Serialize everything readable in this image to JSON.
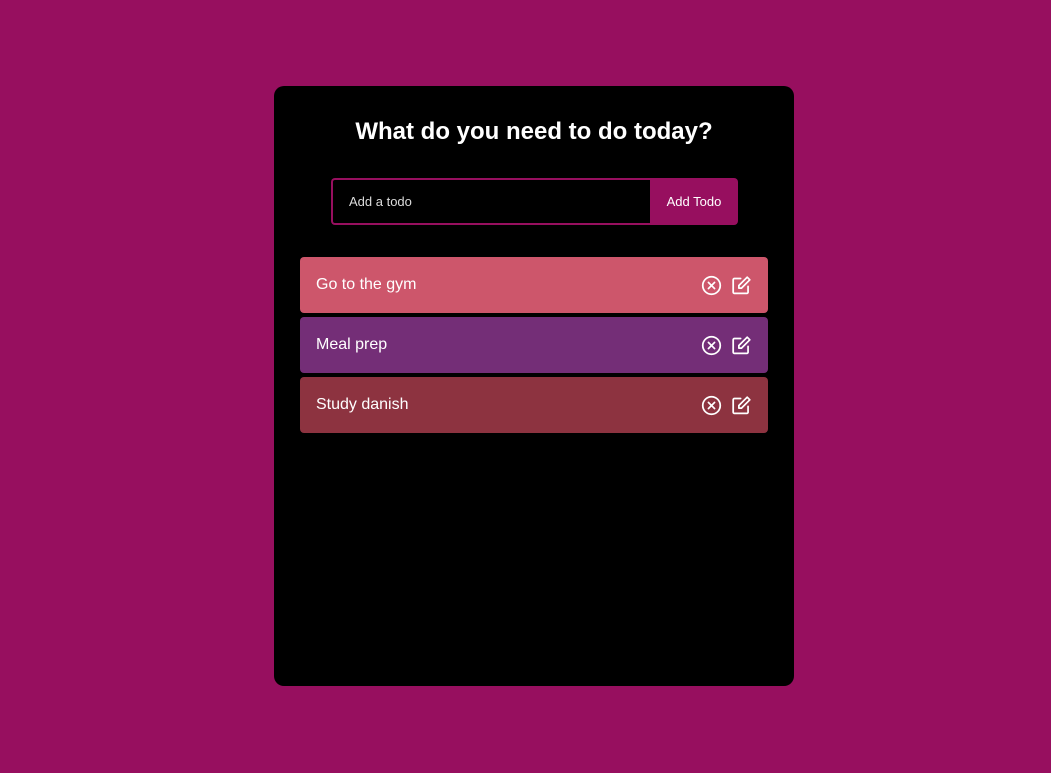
{
  "header": {
    "title": "What do you need to do today?"
  },
  "form": {
    "placeholder": "Add a todo",
    "value": "",
    "button_label": "Add Todo"
  },
  "todos": [
    {
      "text": "Go to the gym",
      "color": "#cd566b"
    },
    {
      "text": "Meal prep",
      "color": "#742e77"
    },
    {
      "text": "Study danish",
      "color": "#8d3340"
    }
  ],
  "icons": {
    "delete": "close-circle-icon",
    "edit": "edit-icon"
  },
  "colors": {
    "background": "#970f5f",
    "app_background": "#000000",
    "accent": "#970f5f",
    "text": "#ffffff"
  }
}
